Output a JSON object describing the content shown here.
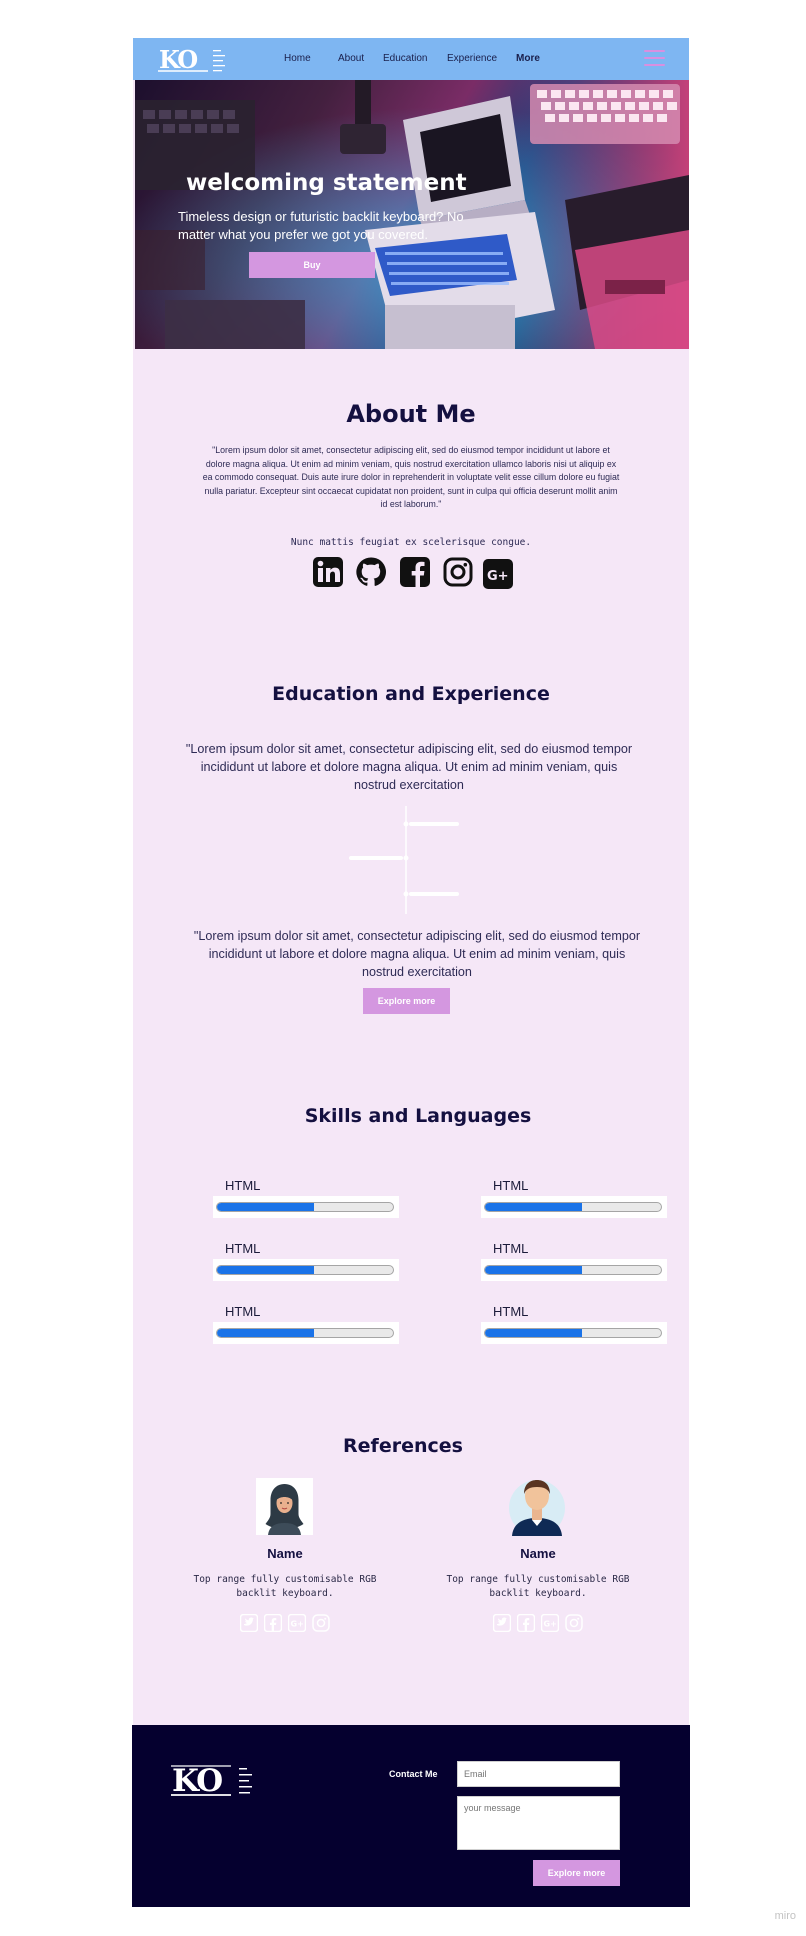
{
  "nav": {
    "logo_letters": "KO",
    "items": [
      "Home",
      "About",
      "Education",
      "Experience",
      "More"
    ]
  },
  "hero": {
    "title": "welcoming statement",
    "subtitle": "Timeless design or futuristic backlit keyboard? No matter what you prefer we got you covered.",
    "button": "Buy"
  },
  "about": {
    "title": "About Me",
    "text": "\"Lorem ipsum dolor sit amet, consectetur adipiscing elit, sed do eiusmod tempor incididunt ut labore et dolore magna aliqua. Ut enim ad minim veniam, quis nostrud exercitation ullamco laboris nisi ut aliquip ex ea commodo consequat. Duis aute irure dolor in reprehenderit in voluptate velit esse cillum dolore eu fugiat nulla pariatur. Excepteur sint occaecat cupidatat non proident, sunt in culpa qui officia deserunt mollit anim id est laborum.\"",
    "tagline": "Nunc mattis feugiat ex scelerisque congue.",
    "socials": [
      "linkedin-icon",
      "github-icon",
      "facebook-icon",
      "instagram-icon",
      "google-plus-icon"
    ]
  },
  "education": {
    "title": "Education and Experience",
    "text1": "\"Lorem ipsum dolor sit amet, consectetur adipiscing elit, sed do eiusmod tempor incididunt ut labore et dolore magna aliqua. Ut enim ad minim veniam, quis nostrud exercitation",
    "text2": "\"Lorem ipsum dolor sit amet, consectetur adipiscing elit, sed do eiusmod tempor incididunt ut labore et dolore magna aliqua. Ut enim ad minim veniam, quis nostrud exercitation",
    "button": "Explore more"
  },
  "skills": {
    "title": "Skills and Languages",
    "items": [
      {
        "label": "HTML",
        "level": 0.55
      },
      {
        "label": "HTML",
        "level": 0.55
      },
      {
        "label": "HTML",
        "level": 0.55
      },
      {
        "label": "HTML",
        "level": 0.55
      },
      {
        "label": "HTML",
        "level": 0.55
      },
      {
        "label": "HTML",
        "level": 0.55
      }
    ]
  },
  "references": {
    "title": "References",
    "people": [
      {
        "name": "Name",
        "desc": "Top range fully customisable RGB backlit keyboard."
      },
      {
        "name": "Name",
        "desc": "Top range fully customisable RGB backlit keyboard."
      }
    ],
    "icons": [
      "twitter-icon",
      "facebook-icon",
      "google-plus-icon",
      "instagram-icon"
    ]
  },
  "footer": {
    "logo_letters": "KO",
    "contact_label": "Contact Me",
    "email_placeholder": "Email",
    "message_placeholder": "your message",
    "button": "Explore more"
  },
  "watermark": "miro",
  "colors": {
    "header": "#7eb6f2",
    "page": "#f5e7f7",
    "accent_button": "#d497e0",
    "heading": "#141040",
    "footer": "#05002f",
    "skill_fill": "#1a73e8"
  }
}
